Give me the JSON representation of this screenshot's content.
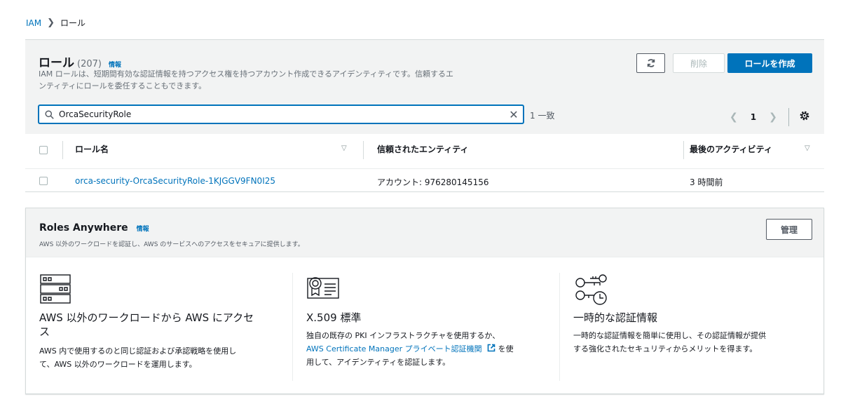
{
  "breadcrumb": {
    "root": "IAM",
    "current": "ロール"
  },
  "roles": {
    "title": "ロール",
    "count": "(207)",
    "info": "情報",
    "description_line1": "IAM ロールは、短期間有効な認証情報を持つアクセス権を持つアカウント作成できるアイデンティティです。信頼するエ",
    "description_line2": "ンティティにロールを委任することもできます。",
    "delete_label": "削除",
    "create_label": "ロールを作成",
    "search_value": "OrcaSecurityRole",
    "match_count": "1 一致",
    "page": "1",
    "columns": {
      "name": "ロール名",
      "trusted": "信頼されたエンティティ",
      "last_activity": "最後のアクティビティ"
    },
    "rows": [
      {
        "name": "orca-security-OrcaSecurityRole-1KJGGV9FN0I25",
        "trusted": "アカウント: 976280145156",
        "last_activity": "3 時間前"
      }
    ]
  },
  "roles_anywhere": {
    "title": "Roles Anywhere",
    "info": "情報",
    "description": "AWS 以外のワークロードを認証し、AWS のサービスへのアクセスをセキュアに提供します。",
    "manage_label": "管理",
    "features": [
      {
        "icon": "server-icon",
        "title_line1": "AWS 以外のワークロードから AWS にアクセ",
        "title_line2": "ス",
        "desc_line1": "AWS 内で使用するのと同じ認証および承認戦略を使用し",
        "desc_line2": "て、AWS 以外のワークロードを運用します。"
      },
      {
        "icon": "certificate-icon",
        "title_line1": "X.509 標準",
        "desc_line1": "独自の既存の PKI インフラストラクチャを使用するか、",
        "desc_link": "AWS Certificate Manager プライベート認証機関",
        "desc_after_link": " を使",
        "desc_line3": "用して、アイデンティティを認証します。"
      },
      {
        "icon": "temporary-credentials-icon",
        "title_line1": "一時的な認証情報",
        "desc_line1": "一時的な認証情報を簡単に使用し、その認証情報が提供",
        "desc_line2": "する強化されたセキュリティからメリットを得ます。"
      }
    ]
  },
  "colors": {
    "link": "#0073bb",
    "primary_button": "#0073bb",
    "header_bg": "#f2f3f3",
    "border": "#d5dbdb"
  }
}
